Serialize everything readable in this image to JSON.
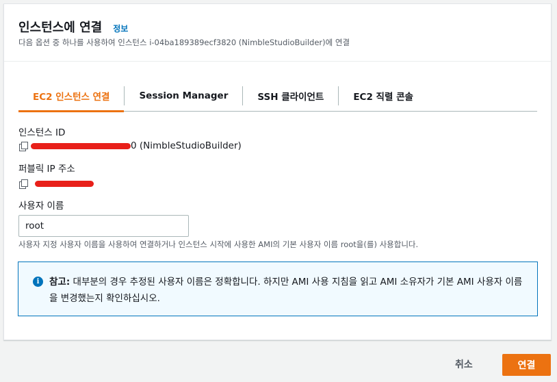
{
  "dialog": {
    "title": "인스턴스에 연결",
    "info_link": "정보",
    "subtitle": "다음 옵션 중 하나를 사용하여 인스턴스 i-04ba189389ecf3820 (NimbleStudioBuilder)에 연결"
  },
  "tabs": [
    {
      "label": "EC2 인스턴스 연결",
      "active": true
    },
    {
      "label": "Session Manager",
      "active": false
    },
    {
      "label": "SSH 클라이언트",
      "active": false
    },
    {
      "label": "EC2 직렬 콘솔",
      "active": false
    }
  ],
  "instance_id": {
    "label": "인스턴스 ID",
    "suffix": "0 (NimbleStudioBuilder)"
  },
  "public_ip": {
    "label": "퍼블릭 IP 주소"
  },
  "username": {
    "label": "사용자 이름",
    "value": "root",
    "hint": "사용자 지정 사용자 이름을 사용하여 연결하거나 인스턴스 시작에 사용한 AMI의 기본 사용자 이름 root을(를) 사용합니다."
  },
  "alert": {
    "icon": "info-icon",
    "strong": "참고:",
    "text": " 대부분의 경우 추정된 사용자 이름은 정확합니다. 하지만 AMI 사용 지침을 읽고 AMI 소유자가 기본 AMI 사용자 이름을 변경했는지 확인하십시오."
  },
  "footer": {
    "cancel_label": "취소",
    "connect_label": "연결"
  },
  "colors": {
    "accent": "#ec7211",
    "link": "#0073bb",
    "redaction": "#e8201a"
  }
}
